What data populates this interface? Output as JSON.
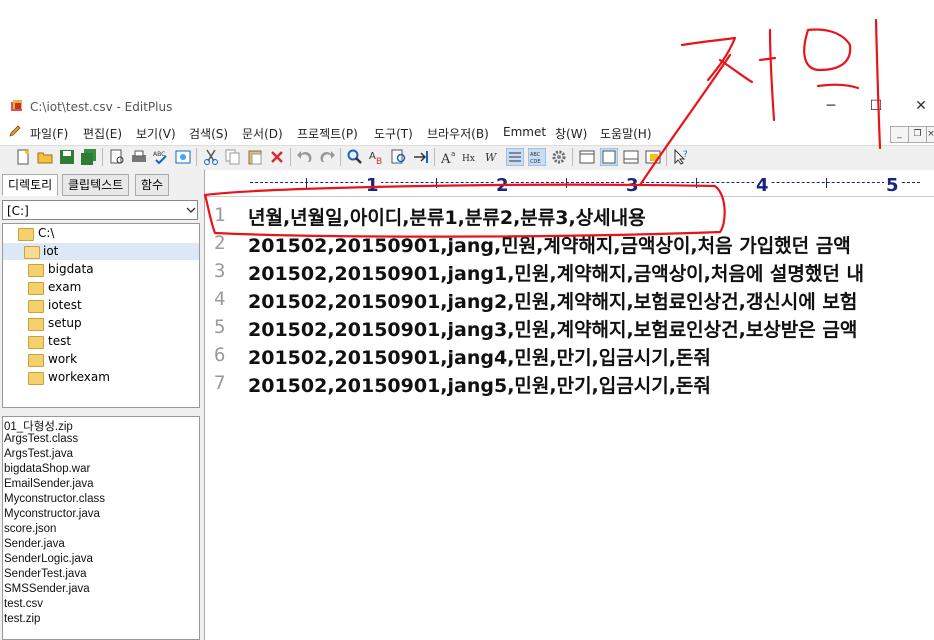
{
  "window": {
    "title": "C:\\iot\\test.csv - EditPlus"
  },
  "menu": [
    {
      "label": "파일(F)"
    },
    {
      "label": "편집(E)"
    },
    {
      "label": "보기(V)"
    },
    {
      "label": "검색(S)"
    },
    {
      "label": "문서(D)"
    },
    {
      "label": "프로젝트(P)"
    },
    {
      "label": "도구(T)"
    },
    {
      "label": "브라우저(B)"
    },
    {
      "label": "Emmet"
    },
    {
      "label": "창(W)"
    },
    {
      "label": "도움말(H)"
    }
  ],
  "sidebar": {
    "tabs": [
      {
        "label": "디렉토리"
      },
      {
        "label": "클립텍스트"
      },
      {
        "label": "함수"
      }
    ],
    "drive": "[C:]",
    "tree": [
      {
        "label": "C:\\"
      },
      {
        "label": "iot"
      },
      {
        "label": "bigdata"
      },
      {
        "label": "exam"
      },
      {
        "label": "iotest"
      },
      {
        "label": "setup"
      },
      {
        "label": "test"
      },
      {
        "label": "work"
      },
      {
        "label": "workexam"
      }
    ],
    "files": [
      "01_다형성.zip",
      "ArgsTest.class",
      "ArgsTest.java",
      "bigdataShop.war",
      "EmailSender.java",
      "Myconstructor.class",
      "Myconstructor.java",
      "score.json",
      "Sender.java",
      "SenderLogic.java",
      "SenderTest.java",
      "SMSSender.java",
      "test.csv",
      "test.zip"
    ]
  },
  "ruler": {
    "numbers": [
      "1",
      "2",
      "3",
      "4",
      "5"
    ]
  },
  "editor": {
    "lines": [
      {
        "num": "1",
        "text": "년월,년월일,아이디,분류1,분류2,분류3,상세내용"
      },
      {
        "num": "2",
        "text": "201502,20150901,jang,민원,계약해지,금액상이,처음 가입했던 금액"
      },
      {
        "num": "3",
        "text": "201502,20150901,jang1,민원,계약해지,금액상이,처음에 설명했던 내"
      },
      {
        "num": "4",
        "text": "201502,20150901,jang2,민원,계약해지,보험료인상건,갱신시에 보험"
      },
      {
        "num": "5",
        "text": "201502,20150901,jang3,민원,계약해지,보험료인상건,보상받은 금액"
      },
      {
        "num": "6",
        "text": "201502,20150901,jang4,민원,만기,입금시기,돈줘"
      },
      {
        "num": "7",
        "text": "201502,20150901,jang5,민원,만기,입금시기,돈줘"
      }
    ]
  },
  "annotation": {
    "color": "#e8141b"
  }
}
